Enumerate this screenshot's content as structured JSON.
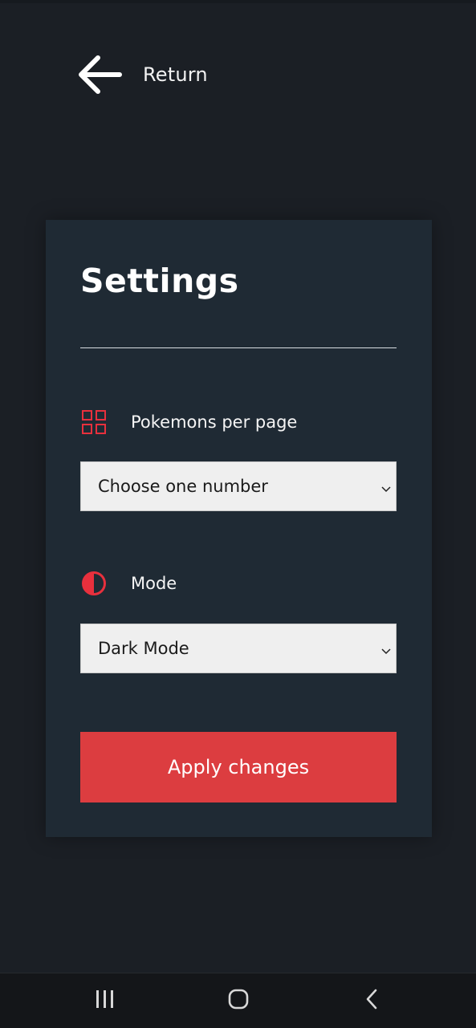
{
  "header": {
    "return_label": "Return",
    "back_icon": "arrow-left-icon"
  },
  "settings": {
    "title": "Settings",
    "per_page": {
      "label": "Pokemons per page",
      "icon": "grid-icon",
      "selected": "Choose one number"
    },
    "mode": {
      "label": "Mode",
      "icon": "contrast-icon",
      "selected": "Dark Mode"
    },
    "apply_label": "Apply changes"
  },
  "navbar": {
    "recents_icon": "recent-apps-icon",
    "home_icon": "home-circle-icon",
    "back_icon": "chevron-left-icon"
  },
  "colors": {
    "background": "#1b1f25",
    "card": "#1f2a34",
    "accent": "#dc3d40",
    "icon_red": "#e8303d"
  }
}
